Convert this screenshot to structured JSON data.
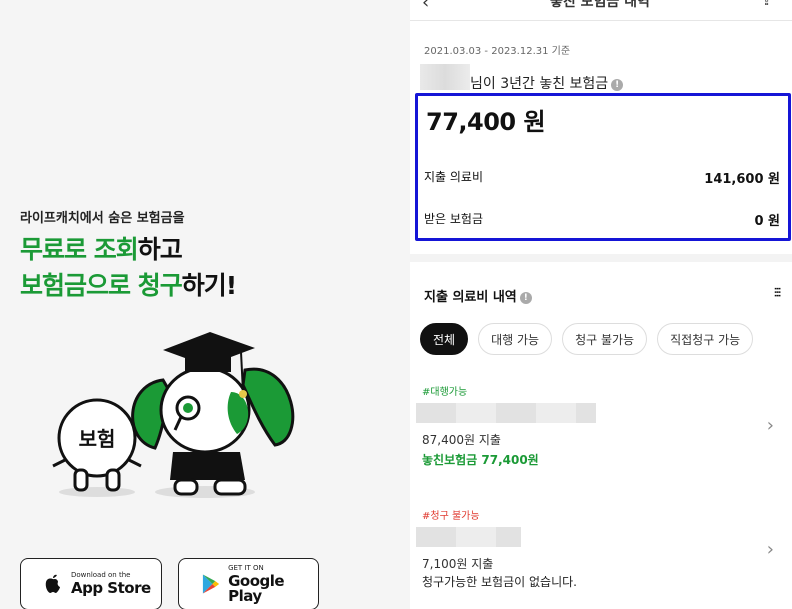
{
  "promo": {
    "subtitle": "라이프캐치에서 숨은 보험금을",
    "line1_green": "무료로 조회",
    "line1_black": "하고",
    "line2_green": "보험금으로 청구",
    "line2_black": "하기!",
    "mascot_sign": "보험"
  },
  "stores": {
    "apple_small": "Download on the",
    "apple_big": "App Store",
    "google_small": "GET IT ON",
    "google_big": "Google Play"
  },
  "header": {
    "title": "놓친 보험금 내역"
  },
  "summary": {
    "period": "2021.03.03 - 2023.12.31 기준",
    "missed_title": "님이 3년간 놓친 보험금",
    "total": "77,400 원",
    "medical_label": "지출 의료비",
    "medical_value": "141,600 원",
    "received_label": "받은 보험금",
    "received_value": "0 원"
  },
  "details": {
    "title": "지출 의료비 내역",
    "chips": [
      "전체",
      "대행 가능",
      "청구 불가능",
      "직접청구 가능"
    ],
    "items": [
      {
        "tag": "#대행가능",
        "spent": "87,400원 지출",
        "note": "놓친보험금 77,400원"
      },
      {
        "tag": "#청구 불가능",
        "spent": "7,100원 지출",
        "note": "청구가능한 보험금이 없습니다."
      }
    ]
  },
  "colors": {
    "brand_green": "#1b9a36",
    "highlight_blue": "#1515d6",
    "tag_red": "#e03a2f"
  }
}
